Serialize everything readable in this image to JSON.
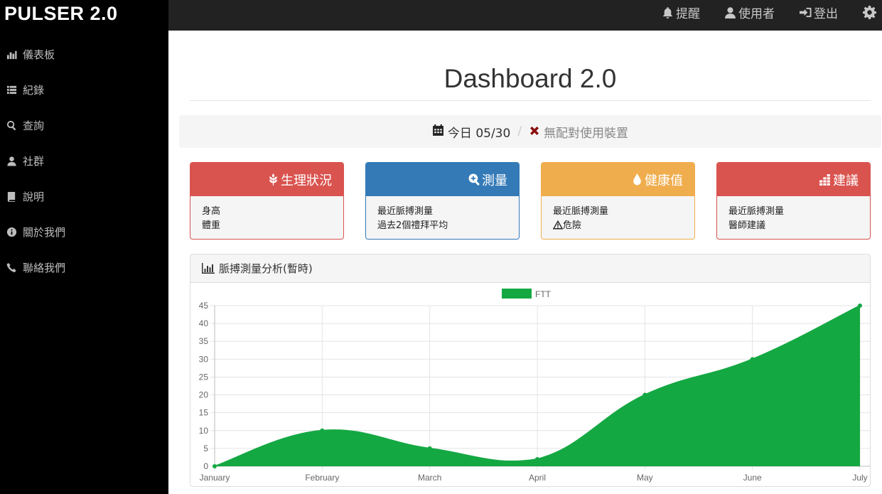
{
  "brand": "PULSER 2.0",
  "sidebar": {
    "items": [
      {
        "label": "儀表板",
        "icon": "bar-chart-icon"
      },
      {
        "label": "紀錄",
        "icon": "list-icon"
      },
      {
        "label": "查詢",
        "icon": "search-icon"
      },
      {
        "label": "社群",
        "icon": "user-icon"
      },
      {
        "label": "說明",
        "icon": "book-icon"
      },
      {
        "label": "關於我們",
        "icon": "info-icon"
      },
      {
        "label": "聯絡我們",
        "icon": "phone-icon"
      }
    ]
  },
  "topbar": {
    "alerts": {
      "label": "提醒",
      "icon": "bell-icon"
    },
    "user": {
      "label": "使用者",
      "icon": "user-icon"
    },
    "logout": {
      "label": "登出",
      "icon": "login-icon"
    },
    "settings": {
      "icon": "gear-icon"
    }
  },
  "page_title": "Dashboard 2.0",
  "status_bar": {
    "date": "今日 05/30",
    "separator": "/",
    "device": "無配對使用裝置"
  },
  "panels": [
    {
      "title": "生理狀況",
      "icon": "grain-icon",
      "color": "#d9534f",
      "lines": [
        "身高",
        "體重"
      ]
    },
    {
      "title": "測量",
      "icon": "zoom-in-icon",
      "color": "#337ab7",
      "lines": [
        "最近脈搏測量",
        "過去2個禮拜平均"
      ]
    },
    {
      "title": "健康值",
      "icon": "tint-icon",
      "color": "#f0ad4e",
      "lines": [
        "最近脈搏測量",
        "危險"
      ]
    },
    {
      "title": "建議",
      "icon": "stats-icon",
      "color": "#d9534f",
      "lines": [
        "最近脈搏測量",
        "醫師建議"
      ]
    }
  ],
  "chart_panel": {
    "title": "脈搏測量分析(暫時)",
    "icon": "bar-chart-icon"
  },
  "chart_data": {
    "type": "area",
    "categories": [
      "January",
      "February",
      "March",
      "April",
      "May",
      "June",
      "July"
    ],
    "series": [
      {
        "name": "FTT",
        "values": [
          0,
          10,
          5,
          2,
          20,
          30,
          45
        ],
        "color": "#14a843"
      }
    ],
    "ylim": [
      0,
      45
    ],
    "yticks": [
      0,
      5,
      10,
      15,
      20,
      25,
      30,
      35,
      40,
      45
    ],
    "grid": true,
    "legend": "top-center"
  }
}
